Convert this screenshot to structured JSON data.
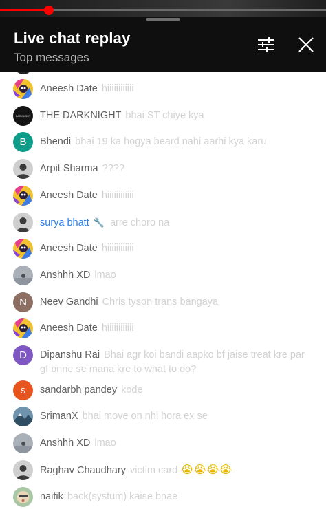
{
  "player": {
    "progress": 0.15
  },
  "header": {
    "title": "Live chat replay",
    "subtitle": "Top messages"
  },
  "messages": [
    {
      "author": "Aneesh Date",
      "text": "hiiiiiiiiiiii",
      "avatar": "colorful-cartoon-avatar"
    },
    {
      "author": "THE DARKNIGHT",
      "text": "bhai ST chiye kya",
      "avatar": "darknight-avatar"
    },
    {
      "author": "Bhendi",
      "text": "bhai 19 ka hogya beard nahi aarhi kya karu",
      "avatar": "letter-avatar",
      "initial": "B",
      "color": "#0f9d8a"
    },
    {
      "author": "Arpit Sharma",
      "text": "????",
      "avatar": "photo-avatar"
    },
    {
      "author": "Aneesh Date",
      "text": "hiiiiiiiiiiii",
      "avatar": "colorful-cartoon-avatar"
    },
    {
      "author": "surya bhatt",
      "text": "arre choro na",
      "avatar": "photo-avatar",
      "moderator": true
    },
    {
      "author": "Aneesh Date",
      "text": "hiiiiiiiiiiii",
      "avatar": "colorful-cartoon-avatar"
    },
    {
      "author": "Anshhh XD",
      "text": "lmao",
      "avatar": "grey-photo-avatar"
    },
    {
      "author": "Neev Gandhi",
      "text": "Chris tyson trans bangaya",
      "avatar": "letter-avatar",
      "initial": "N",
      "color": "#8d6e63"
    },
    {
      "author": "Aneesh Date",
      "text": "hiiiiiiiiiiii",
      "avatar": "colorful-cartoon-avatar"
    },
    {
      "author": "Dipanshu Rai",
      "text": "Bhai agr koi bandi aapko bf jaise treat kre par gf bnne se mana kre to what to do?",
      "avatar": "letter-avatar",
      "initial": "D",
      "color": "#7e57c2"
    },
    {
      "author": "sandarbh pandey",
      "text": "kode",
      "avatar": "letter-avatar",
      "initial": "s",
      "color": "#e8541e"
    },
    {
      "author": "SrimanX",
      "text": "bhai move on nhi hora ex se",
      "avatar": "landscape-avatar"
    },
    {
      "author": "Anshhh XD",
      "text": "lmao",
      "avatar": "grey-photo-avatar"
    },
    {
      "author": "Raghav Chaudhary",
      "text": "victim card",
      "emoji": "😭😭😭😭",
      "avatar": "photo-avatar"
    },
    {
      "author": "naitik",
      "text": "back(systum) kaise bnae",
      "avatar": "cartoon-avatar"
    }
  ],
  "icons": {
    "filter": "tune-sliders-icon",
    "close": "close-icon",
    "moderator": "wrench-icon"
  },
  "colors": {
    "header_bg": "#0f0f0f",
    "progress": "#ff0000",
    "author": "#606060",
    "moderator": "#2b7de9",
    "message": "#d2d2d2"
  }
}
